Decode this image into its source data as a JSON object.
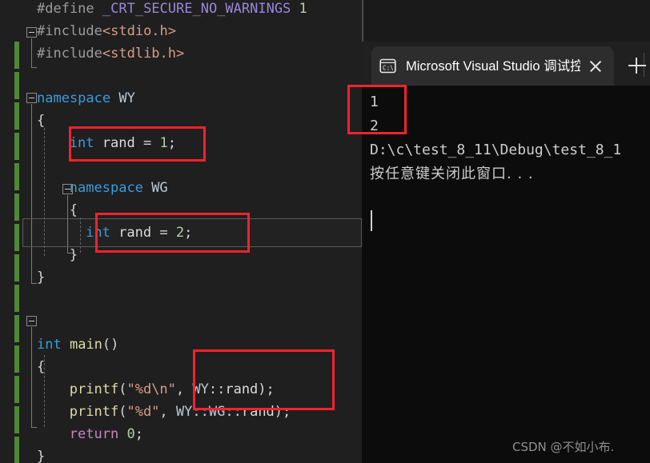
{
  "editor": {
    "name": "visual-studio-code-editor",
    "theme_background": "#1f1f1f",
    "change_bar_color": "#4e8a35",
    "lines": [
      {
        "indent": 0,
        "tokens": [
          {
            "t": "#define ",
            "c": "pp"
          },
          {
            "t": "_CRT_SECURE_NO_WARNINGS",
            "c": "macro"
          },
          {
            "t": " ",
            "c": "plain"
          },
          {
            "t": "1",
            "c": "num"
          }
        ]
      },
      {
        "indent": 0,
        "tokens": [
          {
            "t": "#include",
            "c": "pp"
          },
          {
            "t": "<stdio.h>",
            "c": "header"
          }
        ]
      },
      {
        "indent": 0,
        "tokens": [
          {
            "t": "#include",
            "c": "pp"
          },
          {
            "t": "<stdlib.h>",
            "c": "header"
          }
        ]
      },
      {
        "indent": 0,
        "tokens": []
      },
      {
        "indent": 0,
        "tokens": [
          {
            "t": "namespace",
            "c": "keyword"
          },
          {
            "t": " ",
            "c": "plain"
          },
          {
            "t": "WY",
            "c": "ns"
          }
        ]
      },
      {
        "indent": 0,
        "tokens": [
          {
            "t": "{",
            "c": "punc"
          }
        ]
      },
      {
        "indent": 2,
        "tokens": [
          {
            "t": "int",
            "c": "keyword"
          },
          {
            "t": " ",
            "c": "plain"
          },
          {
            "t": "rand",
            "c": "ident"
          },
          {
            "t": " = ",
            "c": "punc"
          },
          {
            "t": "1",
            "c": "num"
          },
          {
            "t": ";",
            "c": "punc"
          }
        ]
      },
      {
        "indent": 0,
        "tokens": []
      },
      {
        "indent": 2,
        "tokens": [
          {
            "t": "namespace",
            "c": "keyword"
          },
          {
            "t": " ",
            "c": "plain"
          },
          {
            "t": "WG",
            "c": "ns"
          }
        ]
      },
      {
        "indent": 2,
        "tokens": [
          {
            "t": "{",
            "c": "punc"
          }
        ]
      },
      {
        "indent": 3,
        "tokens": [
          {
            "t": "int",
            "c": "keyword"
          },
          {
            "t": " ",
            "c": "plain"
          },
          {
            "t": "rand",
            "c": "ident"
          },
          {
            "t": " = ",
            "c": "punc"
          },
          {
            "t": "2",
            "c": "num"
          },
          {
            "t": ";",
            "c": "punc"
          }
        ]
      },
      {
        "indent": 2,
        "tokens": [
          {
            "t": "}",
            "c": "punc"
          }
        ]
      },
      {
        "indent": 0,
        "tokens": [
          {
            "t": "}",
            "c": "punc"
          }
        ]
      },
      {
        "indent": 0,
        "tokens": []
      },
      {
        "indent": 0,
        "tokens": []
      },
      {
        "indent": 0,
        "tokens": [
          {
            "t": "int",
            "c": "keyword"
          },
          {
            "t": " ",
            "c": "plain"
          },
          {
            "t": "main",
            "c": "fn"
          },
          {
            "t": "()",
            "c": "punc"
          }
        ]
      },
      {
        "indent": 0,
        "tokens": [
          {
            "t": "{",
            "c": "punc"
          }
        ]
      },
      {
        "indent": 2,
        "tokens": [
          {
            "t": "printf",
            "c": "fn"
          },
          {
            "t": "(",
            "c": "punc"
          },
          {
            "t": "\"%d\\n\"",
            "c": "str"
          },
          {
            "t": ", ",
            "c": "punc"
          },
          {
            "t": "WY",
            "c": "ns"
          },
          {
            "t": "::",
            "c": "punc"
          },
          {
            "t": "rand",
            "c": "ident"
          },
          {
            "t": ");",
            "c": "punc"
          }
        ]
      },
      {
        "indent": 2,
        "tokens": [
          {
            "t": "printf",
            "c": "fn"
          },
          {
            "t": "(",
            "c": "punc"
          },
          {
            "t": "\"%d\"",
            "c": "str"
          },
          {
            "t": ", ",
            "c": "punc"
          },
          {
            "t": "WY",
            "c": "ns"
          },
          {
            "t": "::",
            "c": "punc"
          },
          {
            "t": "WG",
            "c": "ns"
          },
          {
            "t": "::",
            "c": "punc"
          },
          {
            "t": "rand",
            "c": "ident"
          },
          {
            "t": ");",
            "c": "punc"
          }
        ]
      },
      {
        "indent": 2,
        "tokens": [
          {
            "t": "return",
            "c": "ctrl"
          },
          {
            "t": " ",
            "c": "plain"
          },
          {
            "t": "0",
            "c": "num"
          },
          {
            "t": ";",
            "c": "punc"
          }
        ]
      },
      {
        "indent": 0,
        "tokens": [
          {
            "t": "}",
            "c": "punc"
          }
        ]
      }
    ]
  },
  "console": {
    "tab": {
      "icon": "console-cmd-icon",
      "icon_label": "C:\\",
      "title": "Microsoft Visual Studio 调试控",
      "close_label": "×",
      "new_tab_label": "+"
    },
    "output": {
      "line1": "1",
      "line2": "2",
      "line3": "D:\\c\\test_8_11\\Debug\\test_8_1",
      "line4": "按任意键关闭此窗口. . ."
    }
  },
  "annotations": {
    "color": "#f5222d",
    "boxes": [
      {
        "name": "annot-rand-1",
        "label": "int rand = 1;"
      },
      {
        "name": "annot-rand-2",
        "label": "int rand = 2;"
      },
      {
        "name": "annot-qualified-names",
        "label": "WY::rand / WY::WG::rand"
      },
      {
        "name": "annot-console-output",
        "label": "1 2"
      }
    ]
  },
  "watermark": {
    "text": "CSDN @不如小布."
  }
}
